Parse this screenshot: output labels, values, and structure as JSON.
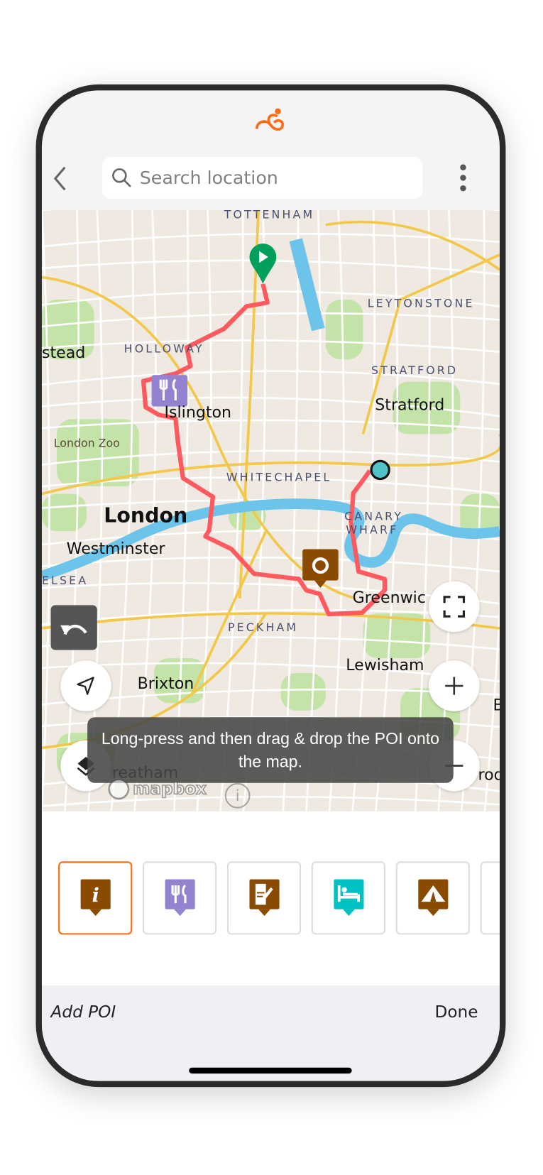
{
  "header": {
    "logo_icon": "cyclist-logo-icon",
    "brand_color": "#ff6a13",
    "back_icon": "chevron-left-icon",
    "menu_icon": "more-vertical-icon"
  },
  "search": {
    "placeholder": "Search location",
    "value": ""
  },
  "map": {
    "labels": [
      {
        "text": "TOTTENHAM",
        "kind": "district"
      },
      {
        "text": "LEYTONSTONE",
        "kind": "district"
      },
      {
        "text": "HOLLOWAY",
        "kind": "district"
      },
      {
        "text": "stead",
        "kind": "city"
      },
      {
        "text": "STRATFORD",
        "kind": "district"
      },
      {
        "text": "Stratford",
        "kind": "city"
      },
      {
        "text": "Islington",
        "kind": "city"
      },
      {
        "text": "London Zoo",
        "kind": "poi"
      },
      {
        "text": "WHITECHAPEL",
        "kind": "district"
      },
      {
        "text": "London",
        "kind": "major"
      },
      {
        "text": "CANARY",
        "kind": "district"
      },
      {
        "text": "WHARF",
        "kind": "district"
      },
      {
        "text": "Westminster",
        "kind": "city"
      },
      {
        "text": "ELSEA",
        "kind": "district"
      },
      {
        "text": "Greenwic",
        "kind": "city"
      },
      {
        "text": "PECKHAM",
        "kind": "district"
      },
      {
        "text": "Lewisham",
        "kind": "city"
      },
      {
        "text": "Brixton",
        "kind": "city"
      },
      {
        "text": "B",
        "kind": "city"
      },
      {
        "text": "rod",
        "kind": "city"
      },
      {
        "text": "reatham",
        "kind": "city"
      }
    ],
    "route_color": "#ff5a5f",
    "start_marker_color": "#00a05a",
    "end_marker_color": "#4fc3c8",
    "attribution": "mapbox",
    "controls": {
      "undo": "undo-icon",
      "locate": "navigation-arrow-icon",
      "layers": "layers-icon",
      "fullscreen": "fullscreen-icon",
      "zoom_in": "plus-icon",
      "zoom_out": "minus-icon"
    },
    "toast": "Long-press and then drag & drop the POI onto the map."
  },
  "poi_tray": {
    "selected_index": 0,
    "items": [
      {
        "icon": "info-icon",
        "color": "#8a4b00"
      },
      {
        "icon": "restaurant-icon",
        "color": "#9282cf"
      },
      {
        "icon": "notes-icon",
        "color": "#8a4b00"
      },
      {
        "icon": "hotel-bed-icon",
        "color": "#00c2c2"
      },
      {
        "icon": "campsite-tent-icon",
        "color": "#8a4b00"
      }
    ]
  },
  "footer": {
    "title": "Add POI",
    "done_label": "Done"
  }
}
